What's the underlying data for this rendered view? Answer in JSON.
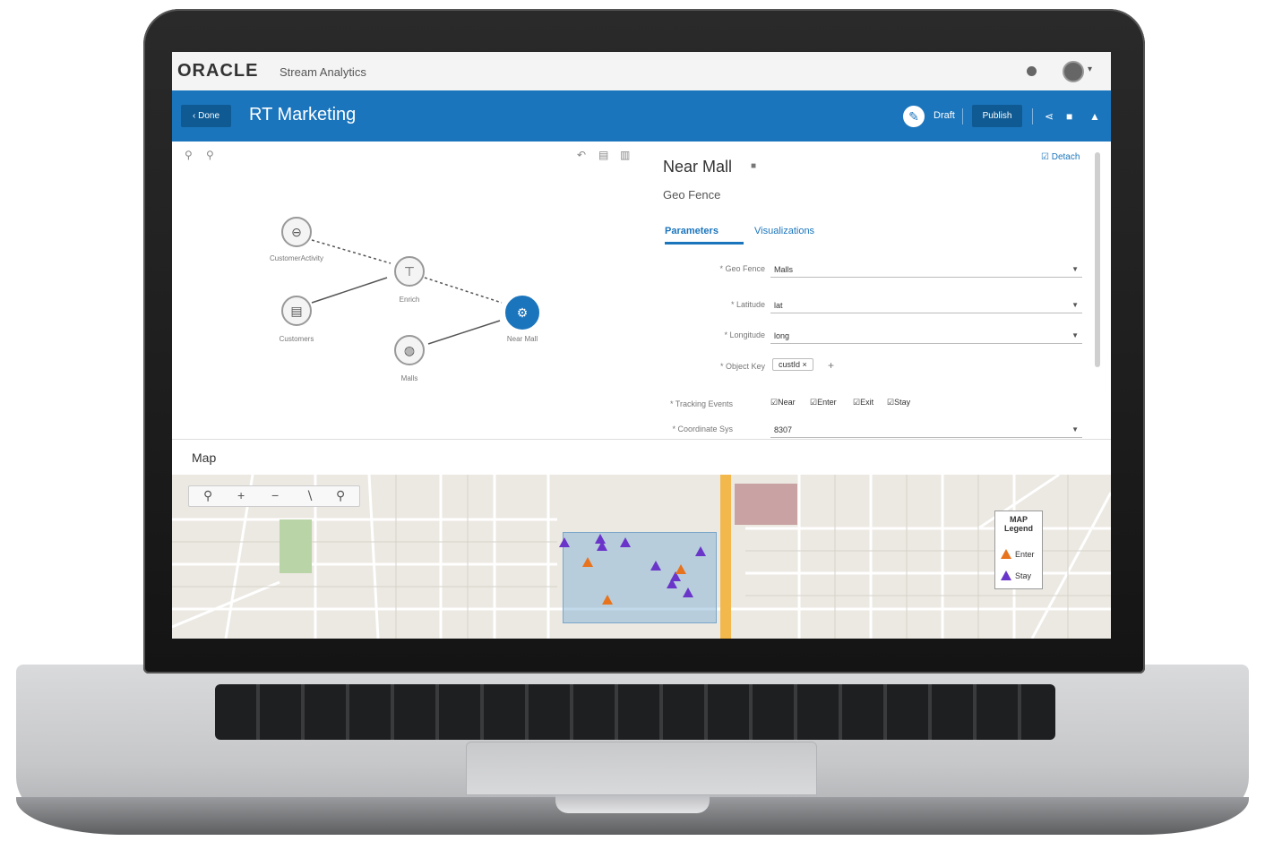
{
  "app": {
    "logo": "ORACLE",
    "product": "Stream Analytics"
  },
  "header": {
    "back_label": "Done",
    "title": "RT Marketing",
    "draft_label": "Draft",
    "publish_label": "Publish"
  },
  "pipeline": {
    "nodes": [
      {
        "label": "CustomerActivity",
        "icon": "stream-icon"
      },
      {
        "label": "Customers",
        "icon": "document-icon"
      },
      {
        "label": "Enrich",
        "icon": "filter-icon"
      },
      {
        "label": "Malls",
        "icon": "globe-icon"
      },
      {
        "label": "Near Mall",
        "icon": "gear-icon"
      }
    ]
  },
  "properties": {
    "title": "Near Mall",
    "subtitle": "Geo Fence",
    "detach_label": "Detach",
    "tabs": [
      "Parameters",
      "Visualizations"
    ],
    "fields": [
      {
        "label": "Geo Fence",
        "value": "Malls"
      },
      {
        "label": "Latitude",
        "value": "lat"
      },
      {
        "label": "Longitude",
        "value": "long"
      },
      {
        "label": "Object Key",
        "value": "custId"
      },
      {
        "label": "Tracking Events",
        "value": ""
      },
      {
        "label": "Coordinate Sys",
        "value": "8307"
      }
    ],
    "tracking_events": [
      "Near",
      "Enter",
      "Exit",
      "Stay"
    ]
  },
  "map": {
    "title": "Map",
    "legend_title": "MAP Legend",
    "legend_items": [
      "Enter",
      "Stay"
    ],
    "colors": {
      "enter": "#e8731d",
      "stay": "#6a35c9",
      "fence": "#7aa6c9",
      "accent": "#1b75bc"
    }
  }
}
